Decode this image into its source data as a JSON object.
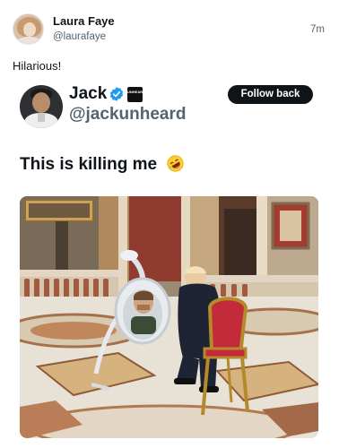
{
  "post": {
    "author_name": "Laura Faye",
    "author_handle": "@laurafaye",
    "time": "7m",
    "text": "Hilarious!"
  },
  "quoted_post": {
    "author_name": "Jack",
    "author_handle": "@jackunheard",
    "badge_text": "UNHEARD",
    "follow_label": "Follow back",
    "text": "This is killing me",
    "emoji_icon": "rolling-on-floor-laughing-icon",
    "verified_icon": "verified-badge-icon"
  },
  "colors": {
    "primary_text": "#0f1419",
    "secondary_text": "#536471",
    "verified": "#1d9bf0",
    "follow_button_bg": "#0f1419"
  }
}
